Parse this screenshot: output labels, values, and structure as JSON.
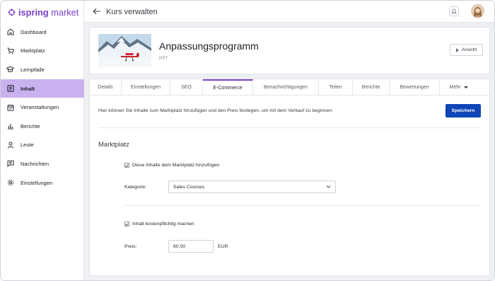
{
  "app": {
    "logo_text_bold": "ispring",
    "logo_text_light": " market",
    "brand_color": "#7c43c9"
  },
  "sidebar": {
    "items": [
      {
        "label": "Dashboard",
        "icon": "home-icon"
      },
      {
        "label": "Marktplatz",
        "icon": "cart-icon"
      },
      {
        "label": "Lernpfade",
        "icon": "graduation-cap-icon"
      },
      {
        "label": "Inhalt",
        "icon": "content-icon",
        "active": true
      },
      {
        "label": "Veranstaltungen",
        "icon": "calendar-icon"
      },
      {
        "label": "Berichte",
        "icon": "bar-chart-icon"
      },
      {
        "label": "Leute",
        "icon": "person-icon"
      },
      {
        "label": "Nachrichten",
        "icon": "messages-icon"
      },
      {
        "label": "Einstellungen",
        "icon": "gear-icon"
      }
    ]
  },
  "header": {
    "title": "Kurs verwalten"
  },
  "course": {
    "title": "Anpassungsprogramm",
    "type": "PPT",
    "view_button": "Ansicht"
  },
  "tabs": [
    {
      "label": "Details"
    },
    {
      "label": "Einstellungen"
    },
    {
      "label": "SEO"
    },
    {
      "label": "E-Commerce",
      "active": true
    },
    {
      "label": "Benachrichtigungen"
    },
    {
      "label": "Teilen"
    },
    {
      "label": "Berichte"
    },
    {
      "label": "Bewertungen"
    },
    {
      "label": "Mehr"
    }
  ],
  "ecommerce": {
    "intro": "Hier können Sie Inhalte zum Marktplatz hinzufügen und den Preis festlegen, um mit dem Verkauf zu beginnen.",
    "save_label": "Speichern",
    "section_title": "Marktplatz",
    "add_to_marketplace_label": "Diese Inhalte dem Marktplatz hinzufügen",
    "add_to_marketplace_checked": true,
    "category_label": "Kategorie:",
    "category_value": "Sales Courses",
    "paid_label": "Inhalt kostenpflichtig machen",
    "paid_checked": true,
    "price_label": "Preis:",
    "price_value": "60.00",
    "currency": "EUR",
    "primary_color": "#0f46b8"
  }
}
